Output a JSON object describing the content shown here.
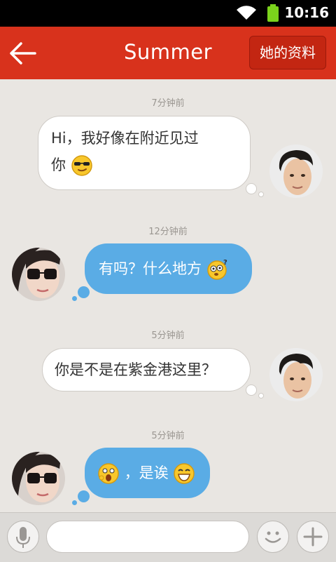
{
  "status_bar": {
    "time": "10:16"
  },
  "header": {
    "title": "Summer",
    "profile_button": "她的资料"
  },
  "messages": [
    {
      "time": "7分钟前",
      "text_line1": "Hi，我好像在附近见过",
      "text_line2": "你"
    },
    {
      "time": "12分钟前",
      "text": "有吗？什么地方"
    },
    {
      "time": "5分钟前",
      "text": "你是不是在紫金港这里？"
    },
    {
      "time": "5分钟前",
      "text": "，是诶"
    }
  ],
  "input": {
    "placeholder": ""
  }
}
